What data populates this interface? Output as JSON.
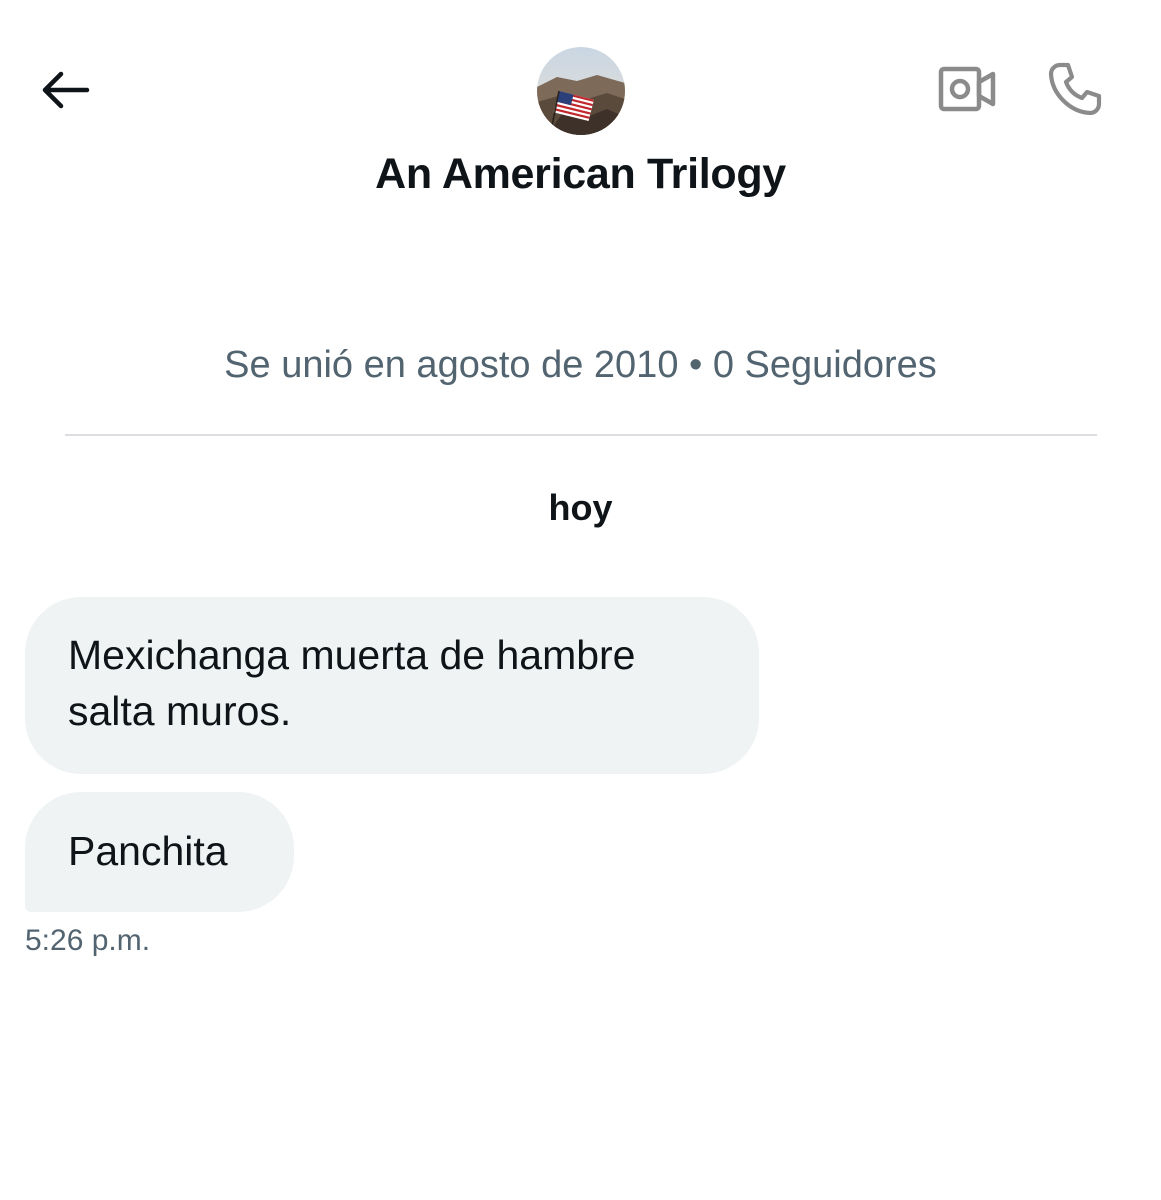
{
  "header": {
    "back_icon": "arrow-left-icon",
    "video_icon": "video-camera-icon",
    "call_icon": "phone-icon",
    "avatar_alt": "profile photo with American flag",
    "display_name": "An American Trilogy"
  },
  "profile_meta": "Se unió en agosto de 2010 • 0 Seguidores",
  "conversation": {
    "day_label": "hoy",
    "messages": [
      {
        "text_line1": "Mexichanga muerta de hambre",
        "text_line2": "salta muros."
      },
      {
        "text_line1": "Panchita"
      }
    ],
    "timestamp": "5:26 p.m."
  },
  "colors": {
    "bubble_bg": "#eff3f4",
    "secondary_text": "#536471",
    "primary_text": "#0f1419",
    "icon_gray": "#8b8b8b"
  }
}
